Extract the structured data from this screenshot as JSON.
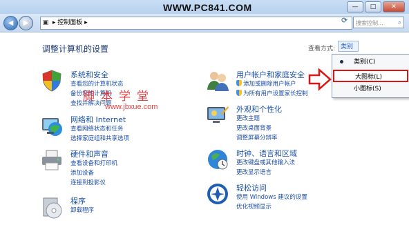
{
  "watermark": {
    "site": "WWW.PC841.COM",
    "cn_text": "脚本学堂",
    "url": "www.jbxue.com"
  },
  "window": {
    "minimize": "—",
    "maximize": "□",
    "close": "✕"
  },
  "nav": {
    "back_icon": "back-arrow-icon",
    "forward_icon": "forward-arrow-icon",
    "breadcrumb": "控制面板",
    "search_placeholder": "搜索控制..."
  },
  "main": {
    "title": "调整计算机的设置"
  },
  "view_by": {
    "label": "查看方式:",
    "value": "类别",
    "menu": [
      {
        "label": "类别(C)",
        "selected": true
      },
      {
        "label": "大图标(L)",
        "highlighted": true
      },
      {
        "label": "小图标(S)"
      }
    ]
  },
  "categories_left": [
    {
      "title": "系统和安全",
      "links": [
        "查看您的计算机状态",
        "备份您的计算机",
        "查找并解决问题"
      ]
    },
    {
      "title": "网络和 Internet",
      "links": [
        "查看网络状态和任务",
        "选择家庭组和共享选项"
      ]
    },
    {
      "title": "硬件和声音",
      "links": [
        "查看设备和打印机",
        "添加设备",
        "连接到投影仪"
      ]
    },
    {
      "title": "程序",
      "links": [
        "卸载程序"
      ]
    }
  ],
  "categories_right": [
    {
      "title": "用户帐户和家庭安全",
      "links": [
        "添加或删除用户帐户",
        "为所有用户设置家长控制"
      ]
    },
    {
      "title": "外观和个性化",
      "links": [
        "更改主题",
        "更改桌面背景",
        "调整屏幕分辨率"
      ]
    },
    {
      "title": "时钟、语言和区域",
      "links": [
        "更改键盘或其他输入法",
        "更改显示语言"
      ]
    },
    {
      "title": "轻松访问",
      "links": [
        "使用 Windows 建议的设置",
        "优化视频显示"
      ]
    }
  ]
}
